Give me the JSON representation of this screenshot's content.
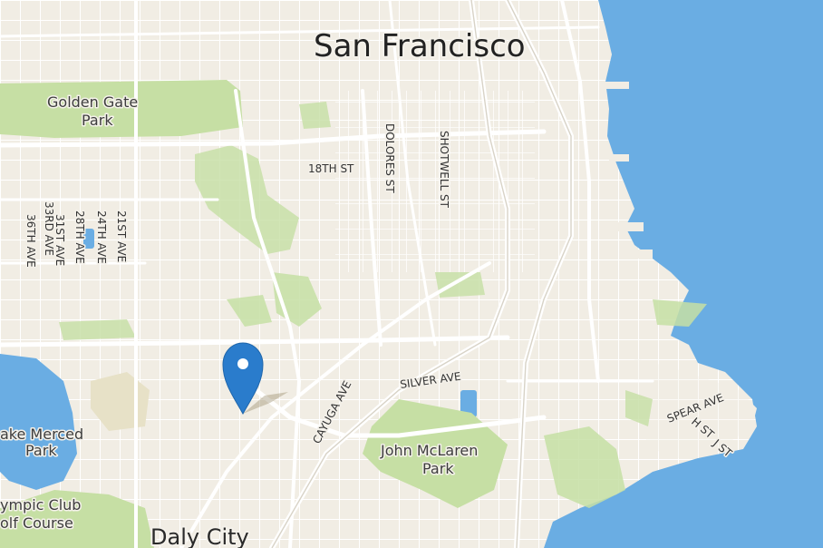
{
  "map": {
    "colors": {
      "land": "#f1ede4",
      "water": "#6aade3",
      "park": "#c6dfa4",
      "road_major": "#ffffff",
      "road_minor": "#fbfaf6",
      "pin": "#2a7ccc"
    },
    "labels": {
      "san_francisco": "San Francisco",
      "golden_gate_park_1": "Golden Gate",
      "golden_gate_park_2": "Park",
      "eighteenth_st": "18TH ST",
      "dolores_st": "DOLORES ST",
      "shotwell_st": "SHOTWELL ST",
      "st_21st": "21ST AVE",
      "st_24th": "24TH AVE",
      "st_28th": "28TH AVE",
      "st_31st": "31ST AVE",
      "st_33rd": "33RD AVE",
      "st_36th": "36TH AVE",
      "cayuga_ave": "CAYUGA AVE",
      "silver_ave": "SILVER AVE",
      "spear_ave": "SPEAR AVE",
      "h_st": "H ST",
      "j_st": "J ST",
      "lake_merced_1": "ake Merced",
      "lake_merced_2": "Park",
      "john_mclaren_1": "John McLaren",
      "john_mclaren_2": "Park",
      "olympic_1": "ympic Club",
      "olympic_2": "olf Course",
      "daly_city": "Daly City"
    },
    "marker": {
      "icon": "map-pin-icon"
    }
  }
}
